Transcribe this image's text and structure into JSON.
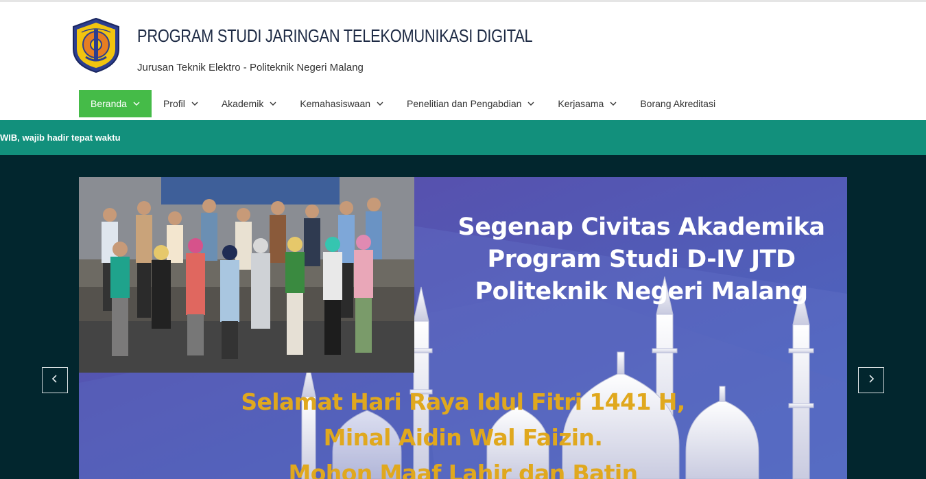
{
  "header": {
    "title": "PROGRAM STUDI JARINGAN TELEKOMUNIKASI DIGITAL",
    "subtitle": "Jurusan Teknik Elektro - Politeknik Negeri Malang",
    "logo_icon": "polinema-logo-icon"
  },
  "nav": {
    "items": [
      {
        "label": "Beranda",
        "active": true,
        "dropdown": true
      },
      {
        "label": "Profil",
        "dropdown": true
      },
      {
        "label": "Akademik",
        "dropdown": true
      },
      {
        "label": "Kemahasiswaan",
        "dropdown": true
      },
      {
        "label": "Penelitian dan Pengabdian",
        "dropdown": true
      },
      {
        "label": "Kerjasama",
        "dropdown": true
      },
      {
        "label": "Borang Akreditasi",
        "dropdown": false
      }
    ],
    "active_color": "#45bb48"
  },
  "ticker": {
    "text": "WIB, wajib hadir tepat waktu",
    "color": "#12907c"
  },
  "slider": {
    "headline": [
      "Segenap Civitas Akademika",
      "Program Studi D-IV JTD",
      "Politeknik Negeri Malang"
    ],
    "greeting": [
      "Selamat Hari Raya Idul Fitri 1441 H,",
      "Minal Aidin Wal Faizin.",
      "Mohon Maaf Lahir dan Batin"
    ],
    "prev_icon": "chevron-left-icon",
    "next_icon": "chevron-right-icon",
    "background_color": "#02262e",
    "headline_color": "#ffffff",
    "greeting_color": "#e0a81e"
  }
}
